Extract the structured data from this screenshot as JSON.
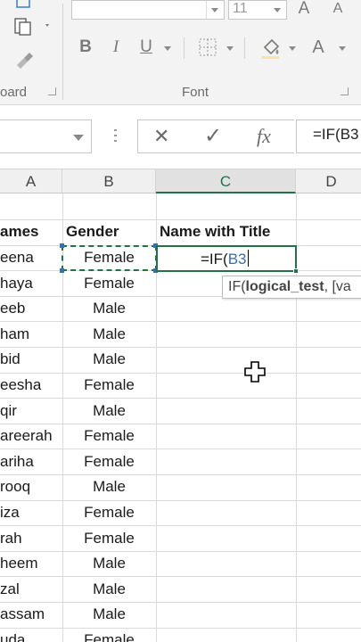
{
  "ribbon": {
    "font_size": "11",
    "bold_label": "B",
    "italic_label": "I",
    "underline_label": "U",
    "font_grow_label": "A",
    "font_shrink_label": "A",
    "font_color_label": "A",
    "clipboard_group_label": "oard",
    "font_group_label": "Font"
  },
  "formula_bar": {
    "cancel_symbol": "✕",
    "enter_symbol": "✓",
    "fx_label": "fx",
    "formula_text": "=IF(B3"
  },
  "sheet": {
    "columns": [
      "A",
      "B",
      "C",
      "D"
    ],
    "selected_column": "C",
    "header_row": [
      "ames",
      "Gender",
      "Name with Title"
    ],
    "rows": [
      {
        "name": "eena",
        "gender": "Female"
      },
      {
        "name": "haya",
        "gender": "Female"
      },
      {
        "name": "eeb",
        "gender": "Male"
      },
      {
        "name": "ham",
        "gender": "Male"
      },
      {
        "name": "bid",
        "gender": "Male"
      },
      {
        "name": "eesha",
        "gender": "Female"
      },
      {
        "name": "qir",
        "gender": "Male"
      },
      {
        "name": "areerah",
        "gender": "Female"
      },
      {
        "name": "ariha",
        "gender": "Female"
      },
      {
        "name": "rooq",
        "gender": "Male"
      },
      {
        "name": "iza",
        "gender": "Female"
      },
      {
        "name": "rah",
        "gender": "Female"
      },
      {
        "name": "heem",
        "gender": "Male"
      },
      {
        "name": "zal",
        "gender": "Male"
      },
      {
        "name": "assam",
        "gender": "Male"
      },
      {
        "name": "uda",
        "gender": "Female"
      }
    ],
    "active_cell": {
      "formula_prefix": "=IF(",
      "reference": "B3"
    },
    "tooltip": {
      "fn": "IF(",
      "arg_bold": "logical_test",
      "rest": ", [va"
    }
  },
  "colors": {
    "accent_green": "#217346",
    "reference_blue": "#2f6fc4"
  }
}
